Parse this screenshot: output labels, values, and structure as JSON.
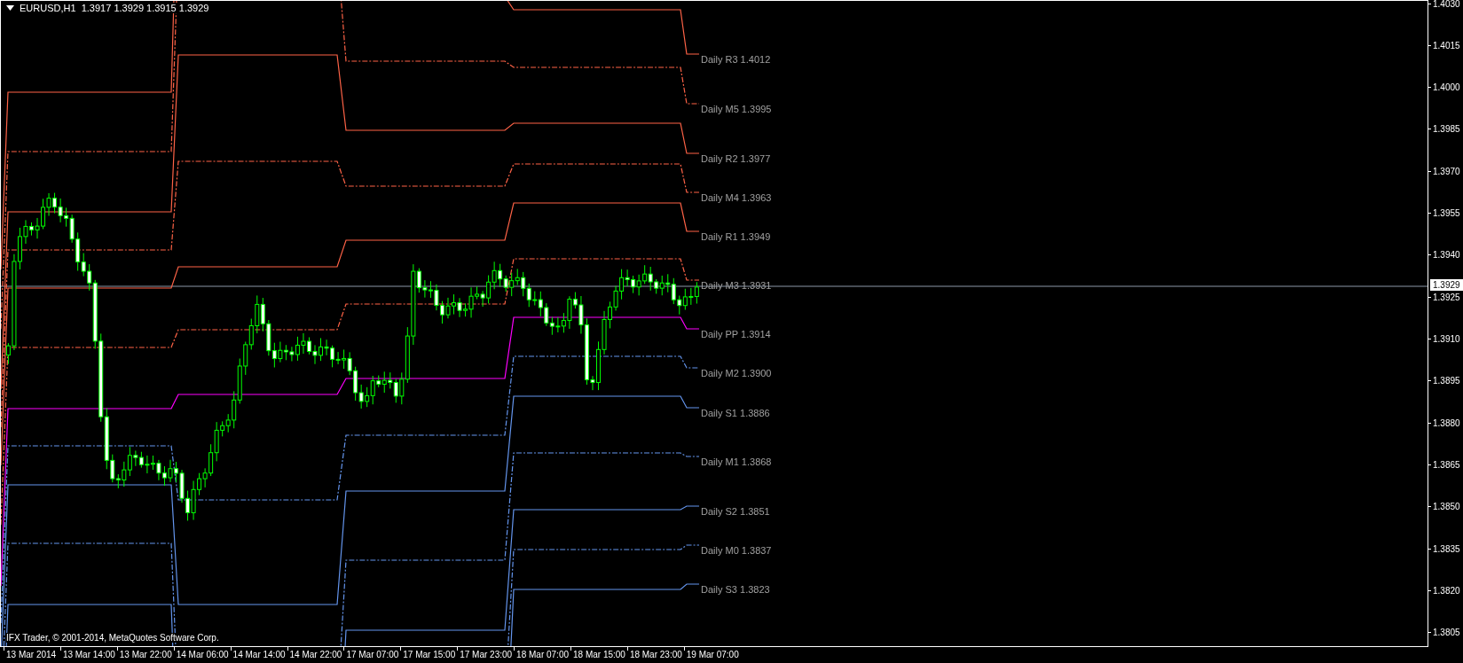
{
  "chart_header": {
    "symbol": "EURUSD,H1",
    "quotes": [
      "1.3917",
      "1.3929",
      "1.3915",
      "1.3929"
    ]
  },
  "levels": [
    {
      "label": "Daily R3 1.4012",
      "color": "#ff6347",
      "kind": "solid"
    },
    {
      "label": "Daily M5 1.3995",
      "color": "#ff6347",
      "kind": "dashed"
    },
    {
      "label": "Daily R2 1.3977",
      "color": "#ff6347",
      "kind": "solid"
    },
    {
      "label": "Daily M4 1.3963",
      "color": "#ff6347",
      "kind": "dashed"
    },
    {
      "label": "Daily R1 1.3949",
      "color": "#ff6347",
      "kind": "solid"
    },
    {
      "label": "Daily M3 1.3931",
      "color": "#ff6347",
      "kind": "dashed"
    },
    {
      "label": "Daily PP 1.3914",
      "color": "#ff00ff",
      "kind": "solid"
    },
    {
      "label": "Daily M2 1.3900",
      "color": "#6495ed",
      "kind": "dashed"
    },
    {
      "label": "Daily S1 1.3886",
      "color": "#6495ed",
      "kind": "solid"
    },
    {
      "label": "Daily M1 1.3868",
      "color": "#6495ed",
      "kind": "dashed"
    },
    {
      "label": "Daily S2 1.3851",
      "color": "#6495ed",
      "kind": "solid"
    },
    {
      "label": "Daily M0 1.3837",
      "color": "#6495ed",
      "kind": "dashed"
    },
    {
      "label": "Daily S3 1.3823",
      "color": "#6495ed",
      "kind": "solid"
    }
  ],
  "price_axis": [
    "1.4030",
    "1.4015",
    "1.4000",
    "1.3985",
    "1.3970",
    "1.3955",
    "1.3940",
    "1.3925",
    "1.3910",
    "1.3895",
    "1.3880",
    "1.3865",
    "1.3850",
    "1.3835",
    "1.3820",
    "1.3805"
  ],
  "current_price": "1.3929",
  "time_axis": [
    "13 Mar 2014",
    "13 Mar 14:00",
    "13 Mar 22:00",
    "14 Mar 06:00",
    "14 Mar 14:00",
    "14 Mar 22:00",
    "17 Mar 07:00",
    "17 Mar 15:00",
    "17 Mar 23:00",
    "18 Mar 07:00",
    "18 Mar 15:00",
    "18 Mar 23:00",
    "19 Mar 07:00"
  ],
  "copyright": "IFX Trader, © 2001-2014, MetaQuotes Software Corp."
}
